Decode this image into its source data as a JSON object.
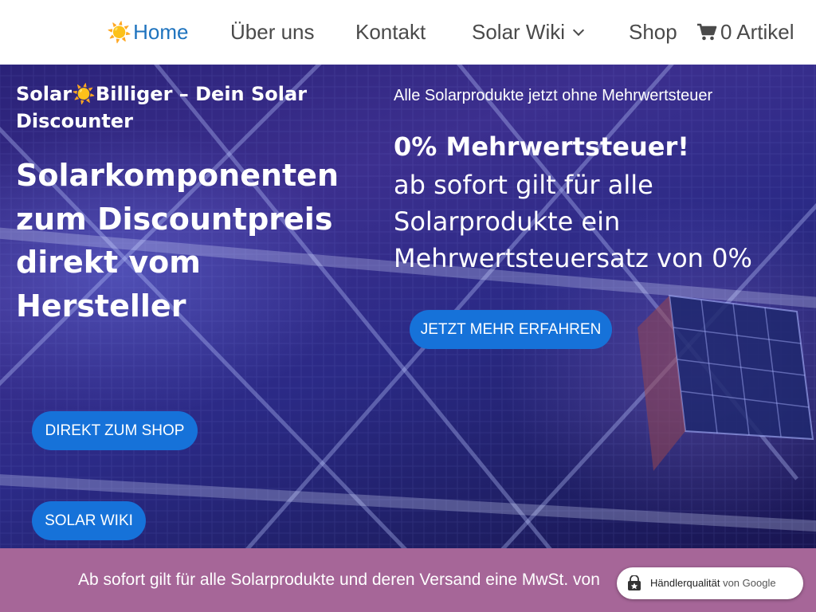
{
  "nav": {
    "home_icon": "☀️",
    "home": "Home",
    "about": "Über uns",
    "contact": "Kontakt",
    "wiki": "Solar Wiki",
    "shop": "Shop",
    "cart": "0 Artikel"
  },
  "hero": {
    "brand_prefix": "Solar",
    "brand_icon": "☀️",
    "brand_suffix": "Billiger – Dein Solar Discounter",
    "headline_1": "Solarkomponenten",
    "headline_2": "zum Discountpreis",
    "headline_3": "direkt vom",
    "headline_4": "Hersteller",
    "tagline": "Alle Solarprodukte jetzt ohne Mehrwertsteuer",
    "vat_title": "0% Mehrwertsteuer!",
    "vat_body": "ab sofort gilt für alle Solarprodukte ein Mehrwertsteuersatz von 0%",
    "btn_more": "JETZT MEHR ERFAHREN",
    "btn_shop": "DIREKT ZUM SHOP",
    "btn_wiki": "SOLAR WIKI"
  },
  "banner": {
    "text": "Ab sofort gilt für alle Solarprodukte und deren Versand eine MwSt. von",
    "badge_label": "Händlerqualität",
    "badge_suffix": "von Google"
  },
  "colors": {
    "accent_blue": "#1672d9",
    "nav_active": "#1e73be",
    "banner_bg": "#a66698",
    "hero_bg": "#2b2a86"
  },
  "icons": [
    "sun-icon",
    "chevron-down-icon",
    "cart-icon",
    "google-shopping-bag-icon"
  ]
}
